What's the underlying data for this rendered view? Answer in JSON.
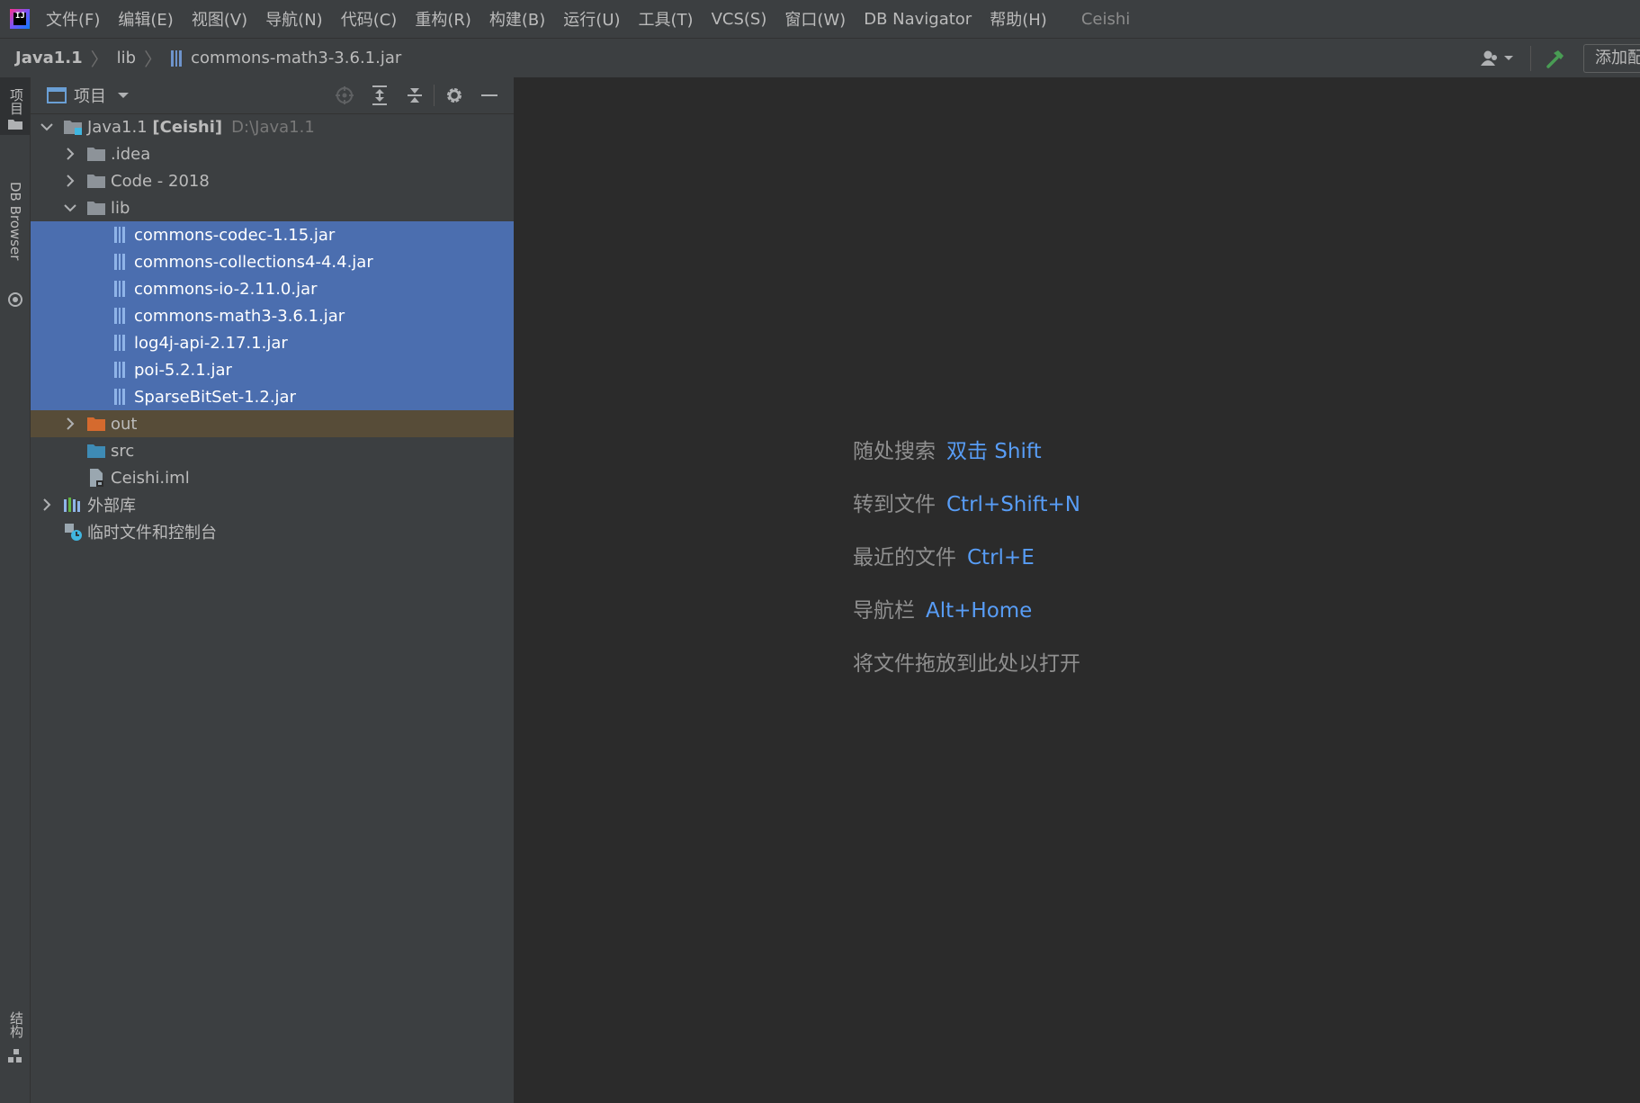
{
  "menubar": {
    "logo_text": "IJ",
    "items": [
      "文件(F)",
      "编辑(E)",
      "视图(V)",
      "导航(N)",
      "代码(C)",
      "重构(R)",
      "构建(B)",
      "运行(U)",
      "工具(T)",
      "VCS(S)",
      "窗口(W)",
      "DB Navigator",
      "帮助(H)"
    ],
    "project_title": "Ceishi"
  },
  "breadcrumb": {
    "items": [
      "Java1.1",
      "lib",
      "commons-math3-3.6.1.jar"
    ],
    "add_config_label": "添加配置..."
  },
  "left_stripe": {
    "project_tab": "项目",
    "db_browser_tab": "DB Browser",
    "structure_tab": "结构"
  },
  "project_panel": {
    "title": "项目",
    "tree": {
      "root_name": "Java1.1",
      "root_module": "[Ceishi]",
      "root_path": "D:\\Java1.1",
      "idea": ".idea",
      "code": "Code - 2018",
      "lib": "lib",
      "jars": [
        "commons-codec-1.15.jar",
        "commons-collections4-4.4.jar",
        "commons-io-2.11.0.jar",
        "commons-math3-3.6.1.jar",
        "log4j-api-2.17.1.jar",
        "poi-5.2.1.jar",
        "SparseBitSet-1.2.jar"
      ],
      "out": "out",
      "src": "src",
      "iml": "Ceishi.iml",
      "external_libs": "外部库",
      "scratches": "临时文件和控制台"
    }
  },
  "editor": {
    "hints": [
      {
        "label": "随处搜索",
        "shortcut": "双击 Shift"
      },
      {
        "label": "转到文件",
        "shortcut": "Ctrl+Shift+N"
      },
      {
        "label": "最近的文件",
        "shortcut": "Ctrl+E"
      },
      {
        "label": "导航栏",
        "shortcut": "Alt+Home"
      },
      {
        "label": "将文件拖放到此处以打开",
        "shortcut": ""
      }
    ]
  },
  "colors": {
    "selection": "#4b6eaf",
    "excluded_folder_bg": "#574c38",
    "shortcut_blue": "#589df6",
    "folder_gray": "#8d9399",
    "folder_orange": "#d56a2e",
    "source_blue": "#3e8bb5"
  }
}
